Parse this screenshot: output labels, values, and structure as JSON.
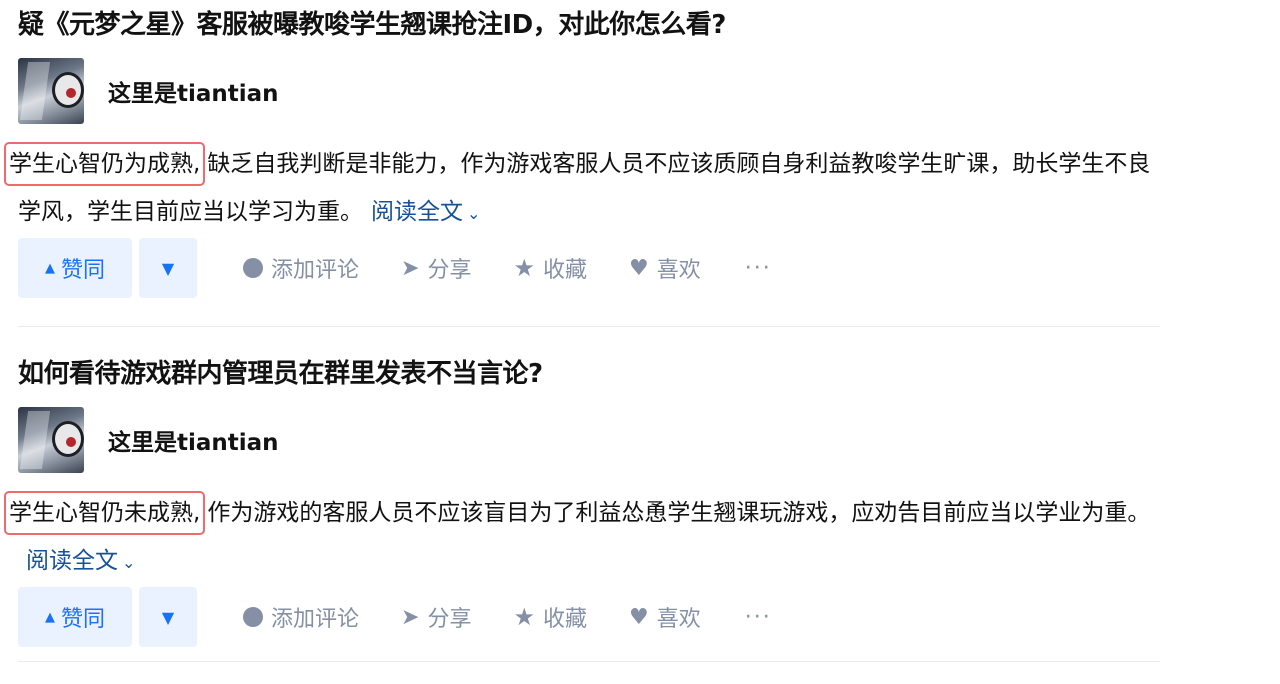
{
  "feed": [
    {
      "title": "疑《元梦之星》客服被曝教唆学生翘课抢注ID，对此你怎么看?",
      "author": "这里是tiantian",
      "highlight": "学生心智仍为成熟,",
      "body": "缺乏自我判断是非能力，作为游戏客服人员不应该质顾自身利益教唆学生旷课，助长学生不良学风，学生目前应当以学习为重。",
      "read_more": "阅读全文",
      "actions": {
        "upvote": "赞同",
        "comment": "添加评论",
        "share": "分享",
        "collect": "收藏",
        "like": "喜欢",
        "more": "···"
      }
    },
    {
      "title": "如何看待游戏群内管理员在群里发表不当言论?",
      "author": "这里是tiantian",
      "highlight": "学生心智仍未成熟,",
      "body": "作为游戏的客服人员不应该盲目为了利益怂恿学生翘课玩游戏，应劝告目前应当以学业为重。",
      "read_more": "阅读全文",
      "actions": {
        "upvote": "赞同",
        "comment": "添加评论",
        "share": "分享",
        "collect": "收藏",
        "like": "喜欢",
        "more": "···"
      }
    }
  ],
  "colors": {
    "accent": "#1772f6",
    "vote_bg": "#ebf2ff",
    "muted": "#8590a6",
    "link": "#175199",
    "highlight_border": "#ef6b6b"
  },
  "icons": {
    "upvote": "triangle-up-icon",
    "downvote": "triangle-down-icon",
    "comment": "comment-bubble-icon",
    "share": "paper-plane-icon",
    "collect": "star-icon",
    "like": "heart-icon",
    "read_more": "chevron-down-icon"
  }
}
